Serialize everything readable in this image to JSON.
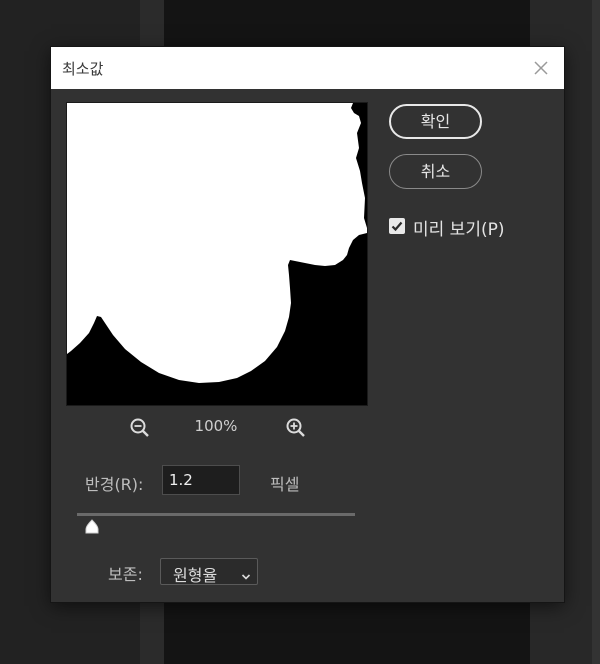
{
  "dialog": {
    "title": "최소값",
    "ok_label": "확인",
    "cancel_label": "취소",
    "preview_checkbox": {
      "label": "미리 보기(P)",
      "checked": true
    },
    "zoom": {
      "level": "100%"
    },
    "radius": {
      "label": "반경(R):",
      "value": "1.2",
      "unit": "픽셀"
    },
    "preserve": {
      "label": "보존:",
      "selected": "원형율"
    }
  }
}
